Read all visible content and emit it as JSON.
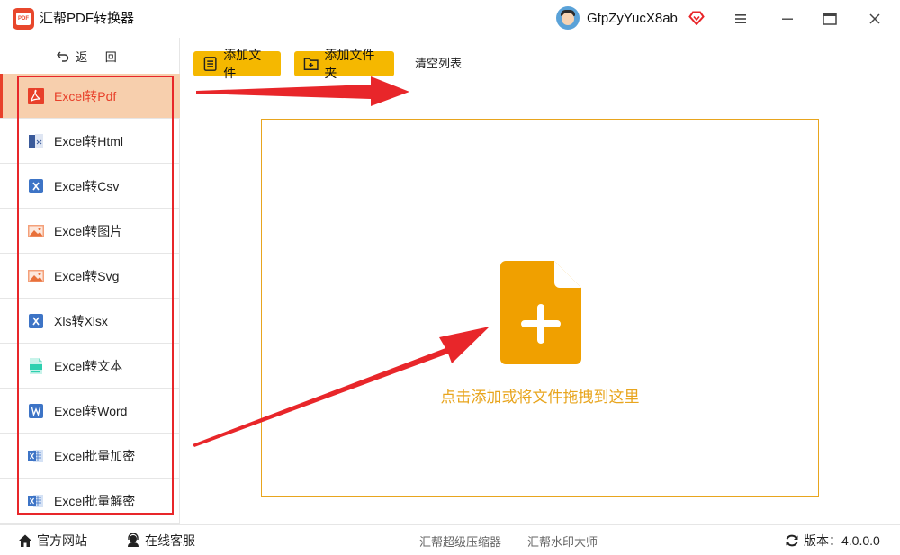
{
  "app": {
    "title": "汇帮PDF转换器",
    "logo_text": "PDF"
  },
  "user": {
    "name": "GfpZyYucX8ab"
  },
  "sidebar": {
    "back_label": "返 回",
    "items": [
      {
        "label": "Excel转Pdf",
        "icon": "pdf-icon",
        "active": true
      },
      {
        "label": "Excel转Html",
        "icon": "html-icon"
      },
      {
        "label": "Excel转Csv",
        "icon": "csv-icon"
      },
      {
        "label": "Excel转图片",
        "icon": "image-icon"
      },
      {
        "label": "Excel转Svg",
        "icon": "svg-image-icon"
      },
      {
        "label": "Xls转Xlsx",
        "icon": "xlsx-icon"
      },
      {
        "label": "Excel转文本",
        "icon": "text-file-icon"
      },
      {
        "label": "Excel转Word",
        "icon": "word-icon"
      },
      {
        "label": "Excel批量加密",
        "icon": "excel-lock-icon"
      },
      {
        "label": "Excel批量解密",
        "icon": "excel-unlock-icon"
      }
    ]
  },
  "toolbar": {
    "add_file": "添加文件",
    "add_folder": "添加文件夹",
    "clear_list": "清空列表"
  },
  "dropzone": {
    "hint": "点击添加或将文件拖拽到这里"
  },
  "footer": {
    "website": "官方网站",
    "service": "在线客服",
    "compress": "汇帮超级压缩器",
    "watermark": "汇帮水印大师",
    "version": "版本：4.0.0.0"
  },
  "colors": {
    "accent": "#f5b800",
    "active_bg": "#f7cfad",
    "active_text": "#e8402a",
    "drop_border": "#e8a51e",
    "annotation_red": "#e8262a"
  }
}
